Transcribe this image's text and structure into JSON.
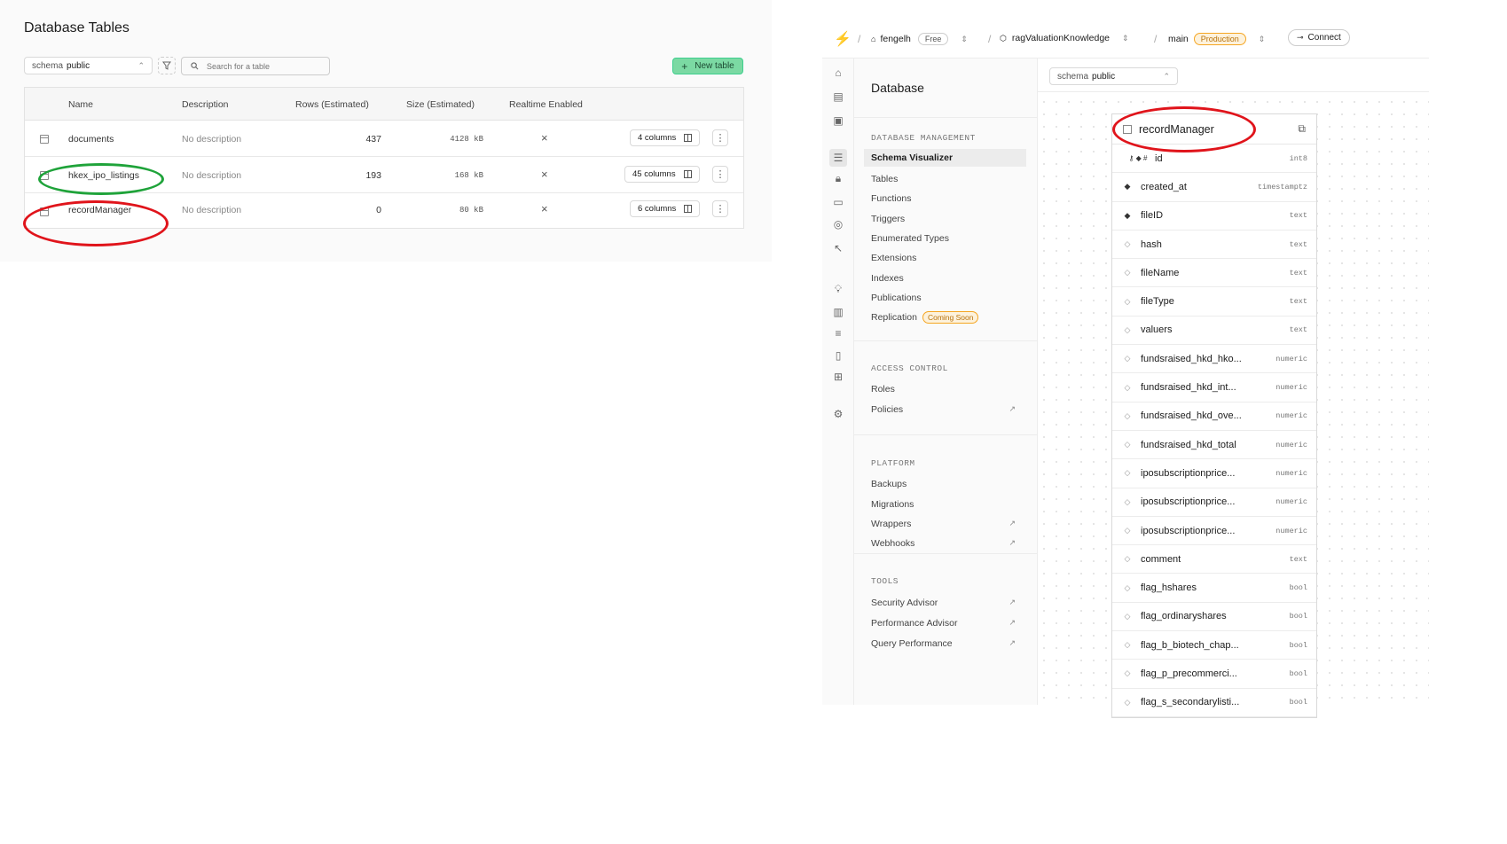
{
  "left_panel": {
    "title": "Database Tables",
    "schema_label": "schema",
    "schema_value": "public",
    "search_placeholder": "Search for a table",
    "new_table_label": "New table",
    "columns": [
      "Name",
      "Description",
      "Rows (Estimated)",
      "Size (Estimated)",
      "Realtime Enabled"
    ],
    "rows": [
      {
        "name": "documents",
        "description": "No description",
        "rows": "437",
        "size": "4128 kB",
        "realtime": "×",
        "columns_btn": "4 columns"
      },
      {
        "name": "hkex_ipo_listings",
        "description": "No description",
        "rows": "193",
        "size": "168 kB",
        "realtime": "×",
        "columns_btn": "45 columns"
      },
      {
        "name": "recordManager",
        "description": "No description",
        "rows": "0",
        "size": "80 kB",
        "realtime": "×",
        "columns_btn": "6 columns"
      }
    ],
    "annotation_colors": {
      "green": "#1fa33a",
      "red": "#e0141b"
    }
  },
  "topbar": {
    "org": "fengelh",
    "plan": "Free",
    "project": "ragValuationKnowledge",
    "branch": "main",
    "env": "Production",
    "connect": "Connect"
  },
  "sidebar": {
    "title": "Database",
    "sections": [
      {
        "heading": "DATABASE MANAGEMENT",
        "items": [
          "Schema Visualizer",
          "Tables",
          "Functions",
          "Triggers",
          "Enumerated Types",
          "Extensions",
          "Indexes",
          "Publications",
          "Replication"
        ]
      },
      {
        "heading": "ACCESS CONTROL",
        "items": [
          "Roles",
          "Policies"
        ]
      },
      {
        "heading": "PLATFORM",
        "items": [
          "Backups",
          "Migrations",
          "Wrappers",
          "Webhooks"
        ]
      },
      {
        "heading": "TOOLS",
        "items": [
          "Security Advisor",
          "Performance Advisor",
          "Query Performance"
        ]
      }
    ],
    "replication_badge": "Coming Soon"
  },
  "visualizer": {
    "schema_label": "schema",
    "schema_value": "public",
    "table_name": "recordManager",
    "rows": [
      {
        "name": "id",
        "type": "int8"
      },
      {
        "name": "created_at",
        "type": "timestamptz"
      },
      {
        "name": "fileID",
        "type": "text"
      },
      {
        "name": "hash",
        "type": "text"
      },
      {
        "name": "fileName",
        "type": "text"
      },
      {
        "name": "fileType",
        "type": "text"
      },
      {
        "name": "valuers",
        "type": "text"
      },
      {
        "name": "fundsraised_hkd_hko...",
        "type": "numeric"
      },
      {
        "name": "fundsraised_hkd_int...",
        "type": "numeric"
      },
      {
        "name": "fundsraised_hkd_ove...",
        "type": "numeric"
      },
      {
        "name": "fundsraised_hkd_total",
        "type": "numeric"
      },
      {
        "name": "iposubscriptionprice...",
        "type": "numeric"
      },
      {
        "name": "iposubscriptionprice...",
        "type": "numeric"
      },
      {
        "name": "iposubscriptionprice...",
        "type": "numeric"
      },
      {
        "name": "comment",
        "type": "text"
      },
      {
        "name": "flag_hshares",
        "type": "bool"
      },
      {
        "name": "flag_ordinaryshares",
        "type": "bool"
      },
      {
        "name": "flag_b_biotech_chap...",
        "type": "bool"
      },
      {
        "name": "flag_p_precommerci...",
        "type": "bool"
      },
      {
        "name": "flag_s_secondarylisti...",
        "type": "bool"
      }
    ]
  }
}
